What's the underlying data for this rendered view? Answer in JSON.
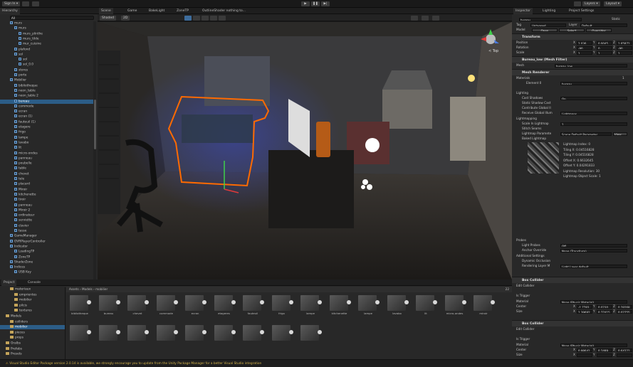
{
  "toolbar": {
    "account": "Sign In",
    "play_icon": "play-icon",
    "pause_icon": "pause-icon",
    "step_icon": "step-icon",
    "layers": "Layers",
    "layout": "Layout"
  },
  "hierarchy": {
    "tab": "Hierarchy",
    "search_placeholder": "All",
    "items": [
      "murs",
      "murs",
      "murs_plinthe",
      "murs_tilde",
      "mur_cuisine",
      "plafond",
      "sol",
      "sol",
      "sol_0.0",
      "stores",
      "porte",
      "Mobilier",
      "bibliotheque",
      "neon_table",
      "neon_table 2",
      "bureau",
      "commode",
      "ecran",
      "ecran (1)",
      "fauteuil (1)",
      "etagere",
      "frigo",
      "lampe",
      "lavabo",
      "lit",
      "micro-ondes",
      "panneau",
      "poubelle",
      "table",
      "chevet",
      "tele",
      "placard",
      "Miroir",
      "kitchenette",
      "tiroir",
      "panneau",
      "Miroir 2",
      "ordinateur",
      "serviette",
      "clavier",
      "tasse",
      "GameManager",
      "OVRPlayerController",
      "Indicator",
      "LoadingTP",
      "ZoneTP",
      "ShaderZone",
      "Indices",
      "USB Key"
    ],
    "selected_index": 15
  },
  "scene": {
    "tabs": [
      "Scene",
      "Game",
      "BakeLight",
      "ZoneTP",
      "OutlineShader nothing to..."
    ],
    "shading": "Shaded",
    "mode": "2D",
    "persp": "< Top"
  },
  "inspector": {
    "tabs": [
      "Inspector",
      "Lighting",
      "Project Settings"
    ],
    "object_name": "bureau",
    "static_label": "Static",
    "tag_label": "Tag",
    "tag_value": "Untagged",
    "layer_label": "Layer",
    "layer_value": "Default",
    "model_label": "Model",
    "open": "Open",
    "select": "Select",
    "overrides": "Overrides",
    "transform": {
      "title": "Transform",
      "position_label": "Position",
      "rotation_label": "Rotation",
      "scale_label": "Scale",
      "position": [
        "2.036",
        "0.0045",
        "1.65871"
      ],
      "rotation": [
        "-90",
        "0",
        "-90"
      ],
      "scale": [
        "1",
        "1",
        "1"
      ]
    },
    "mesh_filter": {
      "title": "Bureau_low (Mesh Filter)",
      "mesh_label": "Mesh",
      "mesh_value": "bureau_low"
    },
    "mesh_renderer": {
      "title": "Mesh Renderer",
      "materials_label": "Materials",
      "materials_count": "1",
      "element0_label": "Element 0",
      "element0_value": "bureau",
      "lighting_label": "Lighting",
      "cast_shadows_label": "Cast Shadows",
      "cast_shadows_value": "On",
      "static_shadow_label": "Static Shadow Cast",
      "contribute_gi_label": "Contribute Global Il",
      "receive_gi_label": "Receive Global Illum",
      "receive_gi_value": "Lightmaps",
      "lightmapping_label": "Lightmapping",
      "scale_lightmap_label": "Scale In Lightmap",
      "scale_lightmap_value": "1",
      "stitch_label": "Stitch Seams",
      "lightmap_params_label": "Lightmap Paramete",
      "lightmap_params_value": "Scene Default Parameter",
      "view_button": "View",
      "baked_label": "Baked Lightmap",
      "baked_info": [
        "Lightmap Index: 0",
        "Tiling X: 0.04516828",
        "Tiling Y: 0.04516828",
        "Offset X: 0.6632645",
        "Offset Y: 0.04291833",
        "Lightmap Resolution: 30",
        "Lightmap Object Scale: 1"
      ],
      "probes_label": "Probes",
      "light_probes_label": "Light Probes",
      "light_probes_value": "Off",
      "anchor_label": "Anchor Override",
      "anchor_value": "None (Transform)",
      "additional_label": "Additional Settings",
      "dynamic_occ_label": "Dynamic Occlusion",
      "rendering_layer_label": "Rendering Layer M",
      "rendering_layer_value": "Light Layer default"
    },
    "box_collider1": {
      "title": "Box Collider",
      "edit_label": "Edit Collider",
      "trigger_label": "Is Trigger",
      "material_label": "Material",
      "material_value": "None (Physic Material)",
      "center_label": "Center",
      "center": [
        "-1.7783",
        "0.0230",
        "0.29268"
      ],
      "size_label": "Size",
      "size": [
        "1.39692",
        "0.77415",
        "0.02755"
      ]
    },
    "box_collider2": {
      "title": "Box Collider",
      "edit_label": "Edit Collider",
      "trigger_label": "Is Trigger",
      "material_label": "Material",
      "material_value": "None (Physic Material)",
      "center_label": "Center",
      "center": [
        "0.98641",
        "0.2489",
        "0.64321"
      ],
      "size_label": "Size",
      "size": [
        "",
        "",
        ""
      ]
    }
  },
  "project": {
    "tabs": [
      "Project",
      "Console"
    ],
    "breadcrumb": [
      "Assets",
      "Models",
      "mobilier"
    ],
    "count": "22",
    "folders": [
      "materiaux",
      "emprientes",
      "mobilier",
      "pilcis",
      "textures",
      "Models",
      "colliders",
      "mobilier",
      "pieces",
      "props",
      "Oralbs",
      "Prefabs",
      "Presets"
    ],
    "assets": [
      "bibliotheque",
      "bureau",
      "chevet",
      "commode",
      "ecran",
      "etageres",
      "fauteuil",
      "frigo",
      "lampe",
      "kitchenette",
      "lampe",
      "lavabo",
      "lit",
      "micro-ondes",
      "miroir",
      "",
      "",
      "",
      "",
      "",
      "",
      "",
      "",
      ""
    ]
  },
  "status": {
    "message": "Visual Studio Editor Package version 2.0.14 is available, we strongly encourage you to update from the Unity Package Manager for a better Visual Studio integration"
  }
}
